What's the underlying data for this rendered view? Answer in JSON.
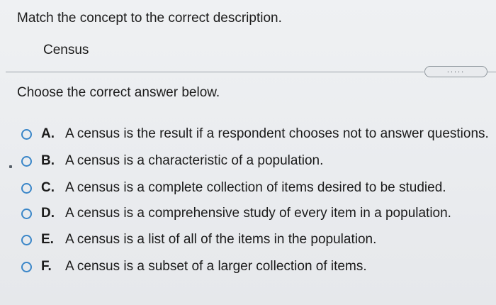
{
  "question": {
    "prompt": "Match the concept to the correct description.",
    "concept": "Census",
    "more_label": ".....",
    "instruction": "Choose the correct answer below."
  },
  "options": [
    {
      "letter": "A.",
      "text": "A census is the result if a respondent chooses not to answer questions."
    },
    {
      "letter": "B.",
      "text": "A census is a characteristic of a population."
    },
    {
      "letter": "C.",
      "text": "A census is a complete collection of items desired to be studied."
    },
    {
      "letter": "D.",
      "text": "A census is a comprehensive study of every item in a population."
    },
    {
      "letter": "E.",
      "text": "A census is a list of all of the items in the population."
    },
    {
      "letter": "F.",
      "text": "A census is a subset of a larger collection of items."
    }
  ],
  "colors": {
    "radio_border": "#3a86c8",
    "text": "#1b1b1b"
  }
}
